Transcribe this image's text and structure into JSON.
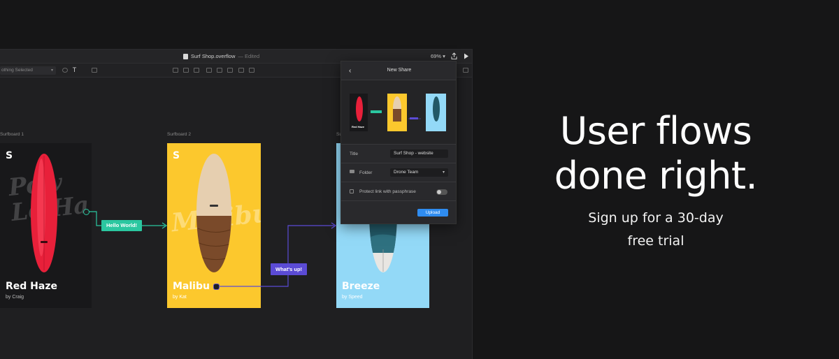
{
  "window": {
    "title": "Surf Shop.overflow",
    "status": "— Edited",
    "zoom": "69% ▾"
  },
  "toolbar": {
    "selection": "othing Selected"
  },
  "frames": [
    {
      "label": "Surfboard 1",
      "logo": "S",
      "name": "Red Haze",
      "author": "by Craig",
      "bg": "#18181a",
      "script": "Pow Le Ha"
    },
    {
      "label": "Surfboard 2",
      "logo": "S",
      "name": "Malibu",
      "author": "by Kat",
      "bg": "#fcc82d",
      "script": "Malibu"
    },
    {
      "label": "Su",
      "logo": "S",
      "name": "Breeze",
      "author": "by Speed",
      "bg": "#93d9f7",
      "script": ""
    }
  ],
  "flows": [
    {
      "label": "Hello World!",
      "color": "#2bc7a0"
    },
    {
      "label": "What's up!",
      "color": "#5b4bd5"
    }
  ],
  "share_panel": {
    "title": "New Share",
    "title_label": "Title",
    "title_value": "Surf Shop - website",
    "folder_label": "Folder",
    "folder_value": "Drone Team",
    "protect_label": "Protect link with passphrase",
    "protect_on": false,
    "upload_label": "Upload",
    "thumb_name": "Red Haze"
  },
  "hero": {
    "title_line1": "User flows",
    "title_line2": "done right.",
    "sub_line1": "Sign up for a 30-day",
    "sub_line2": "free trial"
  },
  "colors": {
    "teal": "#2bc7a0",
    "purple": "#5b4bd5",
    "accent_blue": "#2f8cf0"
  }
}
